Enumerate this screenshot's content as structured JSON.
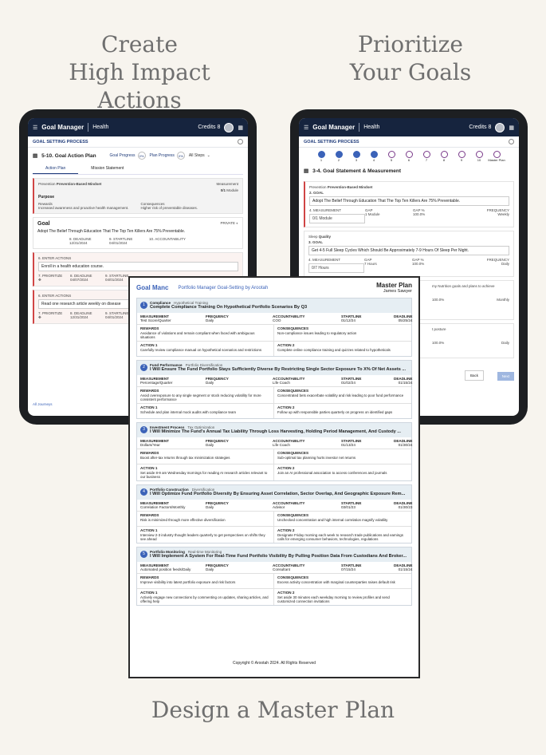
{
  "headlines": {
    "left": [
      "Create",
      "High Impact Actions"
    ],
    "right": [
      "Prioritize",
      "Your Goals"
    ],
    "bottom": "Design a Master Plan"
  },
  "app": {
    "brand": "Goal Manager",
    "section": "Health",
    "credits": "Credits 8",
    "process": "GOAL SETTING PROCESS"
  },
  "left_tablet": {
    "title": "5-10. Goal Action Plan",
    "goal_progress": "Goal Progress",
    "plan_progress": "Plan Progress",
    "progress_val": "0%",
    "steps_dropdown": "All Steps",
    "tabs": [
      "Action Plan",
      "Mission Statement"
    ],
    "prevention": "Prevention",
    "mindset": "Prevention-Based Mindset",
    "measurement_label": "Measurement",
    "measurement_val": "0/1",
    "measurement_unit": "Module",
    "purpose": "Purpose",
    "rewards_label": "Rewards",
    "rewards_text": "Increased awareness and proactive health management.",
    "consequences_label": "Consequences",
    "consequences_text": "Higher risk of preventable diseases.",
    "goal_label": "Goal",
    "private": "PRIVATE",
    "goal_text": "Adopt The Belief Through Education That The Top Ten Killers Are 75% Preventable.",
    "deadline_label": "8. DEADLINE",
    "startline_label": "9. STARTLINE",
    "accountability_label": "10. ACCOUNTABILITY",
    "deadline": "12/31/2024",
    "startline": "04/01/2024",
    "actions": [
      {
        "label": "6. ENTER ACTIONS",
        "text": "Enroll in a health education course.",
        "deadline": "04/07/2024",
        "startline": "04/01/2024"
      },
      {
        "label": "6. ENTER ACTIONS",
        "text": "Read one research article weekly on disease",
        "deadline": "12/31/2024",
        "startline": "04/01/2024"
      }
    ],
    "prioritize": "7. PRIORITIZE",
    "deadline2": "8. DEADLINE",
    "startline2": "9. STARTLINE",
    "all_journeys": "All Journeys"
  },
  "right_tablet": {
    "steps": [
      "1",
      "2",
      "3",
      "4",
      "5",
      "6",
      "7",
      "8",
      "9",
      "10",
      "Master Plan"
    ],
    "title": "3-4. Goal Statement & Measurement",
    "cards": [
      {
        "category": "Prevention",
        "sub": "Prevention-Based Mindset",
        "goal_label": "2. GOAL",
        "goal": "Adopt The Belief Through Education That The Top Ten Killers Are 75% Preventable.",
        "meas": "0/1 Module",
        "gap": "1 Module",
        "gap_pct": "100.0%",
        "freq": "Weekly"
      },
      {
        "category": "Sleep",
        "sub": "Quality",
        "goal_label": "3. GOAL",
        "goal": "Get 4-5 Full Sleep Cycles Which Should Be Approximately 7-9 Hours Of Sleep Per Night.",
        "meas": "0/7 Hours",
        "gap": "7 Hours",
        "gap_pct": "100.0%",
        "freq": "Daily"
      }
    ],
    "meas_label": "4. MEASUREMENT",
    "gap_label": "GAP",
    "gap_pct_label": "GAP %",
    "freq_label": "FREQUENCY",
    "partial_goal": "my Nutrition goals and plans to achieve",
    "partial_gap_pct": "100.0%",
    "partial_freq": "Monthly",
    "partial_posture": "t posture",
    "partial_gap_pct2": "100.0%",
    "partial_freq2": "Daily",
    "back": "Back",
    "next": "Next"
  },
  "doc": {
    "logo": "Goal Manc",
    "portfolio": "Portfolio Manager Goal-Setting by Arootah",
    "title": "Master Plan",
    "person": "James Sawyer",
    "h": {
      "measurement": "MEASUREMENT",
      "frequency": "FREQUENCY",
      "accountability": "ACCOUNTABILITY",
      "startline": "STARTLINE",
      "deadline": "DEADLINE",
      "rewards": "REWARDS",
      "consequences": "CONSEQUENCES",
      "action1": "ACTION 1",
      "action2": "ACTION 2"
    },
    "goals": [
      {
        "n": "1",
        "cat": "Compliance",
        "sub": "Hypothetical Training",
        "title": "Complete Compliance Training On Hypothetical Portfolio Scenarios By Q3",
        "m": "Test Score/Quarter",
        "f": "Daily",
        "a": "COO",
        "s": "01/12/24",
        "d": "05/25/24",
        "r": "Avoidance of violations and remain compliant when faced with ambiguous situations",
        "c": "Non-compliance issues leading to regulatory action",
        "a1": "Carefully review compliance manual on hypothetical scenarios and restrictions",
        "a2": "Complete online compliance training and quizzes related to hypotheticals"
      },
      {
        "n": "2",
        "cat": "Fund Performance",
        "sub": "Portfolio Diversification",
        "title": "I Will Ensure The Fund Portfolio Stays Sufficiently Diverse By Restricting Single Sector Exposure To X% Of Net Assets ...",
        "m": "Percentage/Quarter",
        "f": "Daily",
        "a": "Life Coach",
        "s": "01/02/24",
        "d": "01/15/24",
        "r": "Avoid overexposure to any single segment or stock reducing volatility for more consistent performance",
        "c": "Concentrated bets exacerbate volatility and risk leading to poor fund performance",
        "a1": "Schedule and plan internal mock audits with compliance team",
        "a2": "Follow up with responsible parties quarterly on progress on identified gaps"
      },
      {
        "n": "3",
        "cat": "Investment Process",
        "sub": "Tax Optimization",
        "title": "I Will Minimize The Fund's Annual Tax Liability Through Loss Harvesting, Holding Period Management, And Custody ...",
        "m": "Dollars/Year",
        "f": "Daily",
        "a": "Life Coach",
        "s": "01/13/24",
        "d": "01/30/24",
        "r": "Boost after-tax returns through tax minimization strategies",
        "c": "Sub-optimal tax planning hurts investor net returns",
        "a1": "Set aside 8-9 am Wednesday mornings for reading AI research articles relevant to our business",
        "a2": "Join an AI professional association to access conferences and journals"
      },
      {
        "n": "4",
        "cat": "Portfolio Construction",
        "sub": "Diversification",
        "title": "I Will Optimize Fund Portfolio Diversity By Ensuring Asset Correlation, Sector Overlap, And Geographic Exposure Rem...",
        "m": "Correlation Factors/Monthly",
        "f": "Daily",
        "a": "Advisor",
        "s": "03/01/23",
        "d": "01/30/23",
        "r": "Risk is minimized through more effective diversification",
        "c": "Unchecked concentration and high internal correlation magnify volatility",
        "a1": "Interview 2-3 industry thought leaders quarterly to get perspectives on shifts they see ahead",
        "a2": "Designate Friday morning each week to research trade publications and earnings calls for emerging consumer behaviors, technologies, regulations"
      },
      {
        "n": "5",
        "cat": "Portfolio Monitoring",
        "sub": "Real-time Monitoring",
        "title": "I Will Implement A System For Real-Time Fund Portfolio Visibility By Pulling Position Data From Custodians And Broker...",
        "m": "Automated position feeds/Daily",
        "f": "Daily",
        "a": "Consultant",
        "s": "07/15/24",
        "d": "01/15/24",
        "r": "Improve visibility into latest portfolio exposure and risk factors",
        "c": "Excess activity concentration with marginal counterparties raises default risk",
        "a1": "Actively engage new connections by commenting on updates, sharing articles, and offering help",
        "a2": "Set aside 30 minutes each weekday morning to review profiles and send customized connection invitations"
      }
    ],
    "footer": "Copyright © Arootah 2024. All Rights Reserved"
  }
}
